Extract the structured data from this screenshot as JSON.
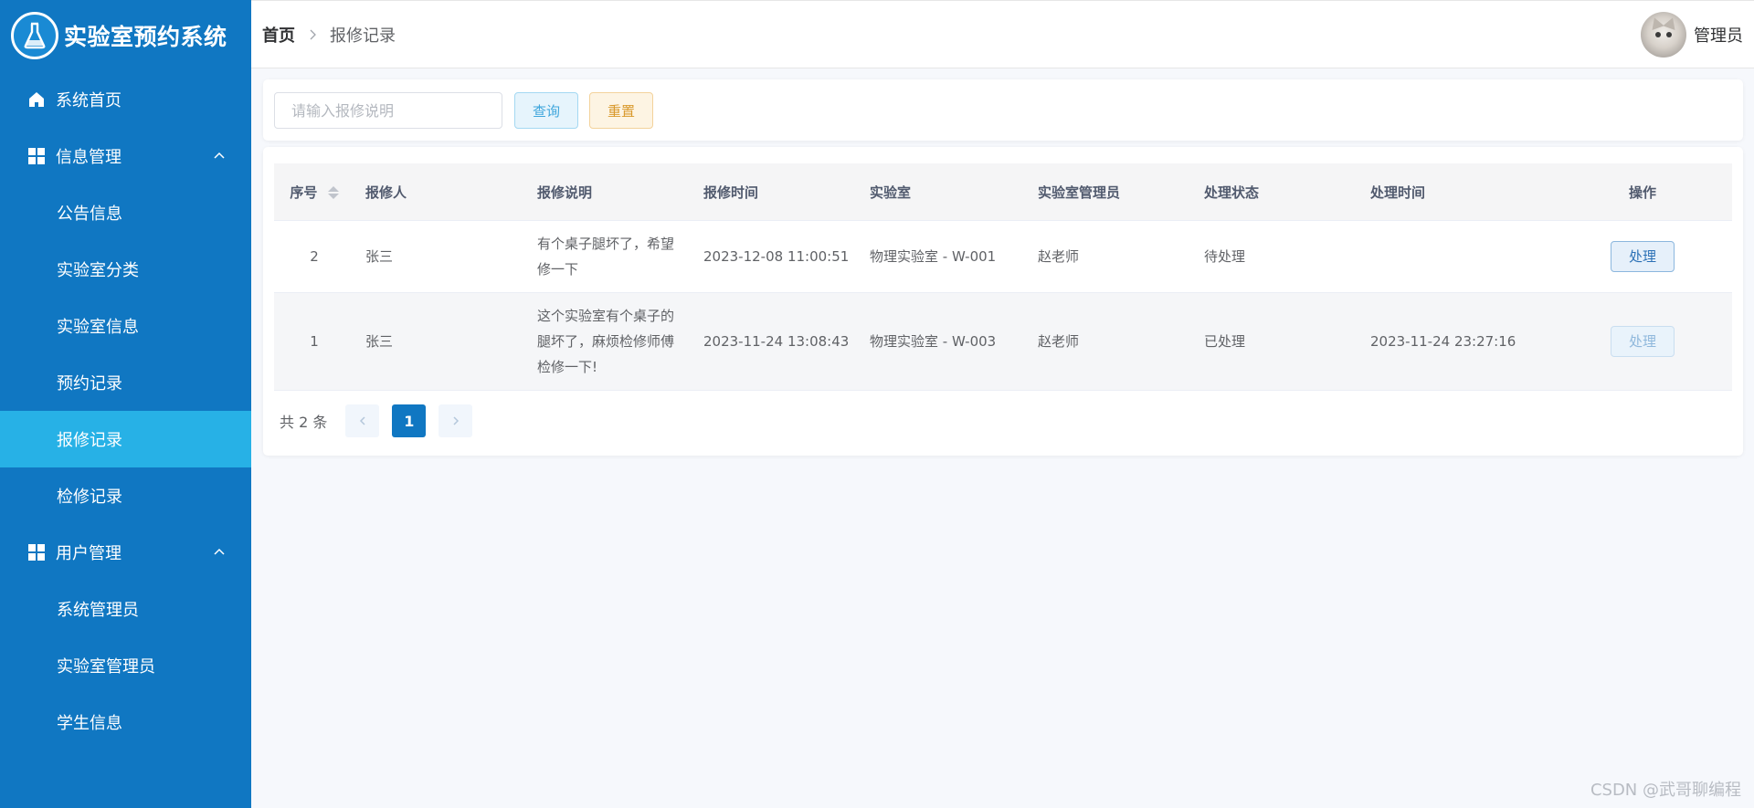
{
  "app": {
    "title": "实验室预约系统",
    "logo_icon": "flask-icon"
  },
  "sidebar": {
    "items": [
      {
        "label": "系统首页",
        "icon": "home-icon"
      },
      {
        "label": "信息管理",
        "icon": "grid-icon",
        "expanded": true
      },
      {
        "label": "公告信息"
      },
      {
        "label": "实验室分类"
      },
      {
        "label": "实验室信息"
      },
      {
        "label": "预约记录"
      },
      {
        "label": "报修记录",
        "active": true
      },
      {
        "label": "检修记录"
      },
      {
        "label": "用户管理",
        "icon": "grid-icon",
        "expanded": true
      },
      {
        "label": "系统管理员"
      },
      {
        "label": "实验室管理员"
      },
      {
        "label": "学生信息"
      }
    ],
    "bg_color": "#1077c2",
    "active_color": "#27b1e6"
  },
  "header": {
    "breadcrumb_home": "首页",
    "breadcrumb_current": "报修记录",
    "user_name": "管理员"
  },
  "search": {
    "placeholder": "请输入报修说明",
    "value": "",
    "query_label": "查询",
    "reset_label": "重置"
  },
  "table": {
    "columns": [
      "序号",
      "报修人",
      "报修说明",
      "报修时间",
      "实验室",
      "实验室管理员",
      "处理状态",
      "处理时间",
      "操作"
    ],
    "rows": [
      {
        "id": "2",
        "reporter": "张三",
        "desc_lines": [
          "有个桌子腿坏了，希望",
          "修一下"
        ],
        "report_time": "2023-12-08 11:00:51",
        "lab": "物理实验室 - W-001",
        "lab_admin": "赵老师",
        "status": "待处理",
        "handle_time": "",
        "action": "处理"
      },
      {
        "id": "1",
        "reporter": "张三",
        "desc_lines": [
          "这个实验室有个桌子的",
          "腿坏了，麻烦检修师傅",
          "检修一下!"
        ],
        "report_time": "2023-11-24 13:08:43",
        "lab": "物理实验室 - W-003",
        "lab_admin": "赵老师",
        "status": "已处理",
        "handle_time": "2023-11-24 23:27:16",
        "action": "处理"
      }
    ]
  },
  "pagination": {
    "total_text": "共 2 条",
    "current_page": "1"
  },
  "watermark": "CSDN @武哥聊编程"
}
